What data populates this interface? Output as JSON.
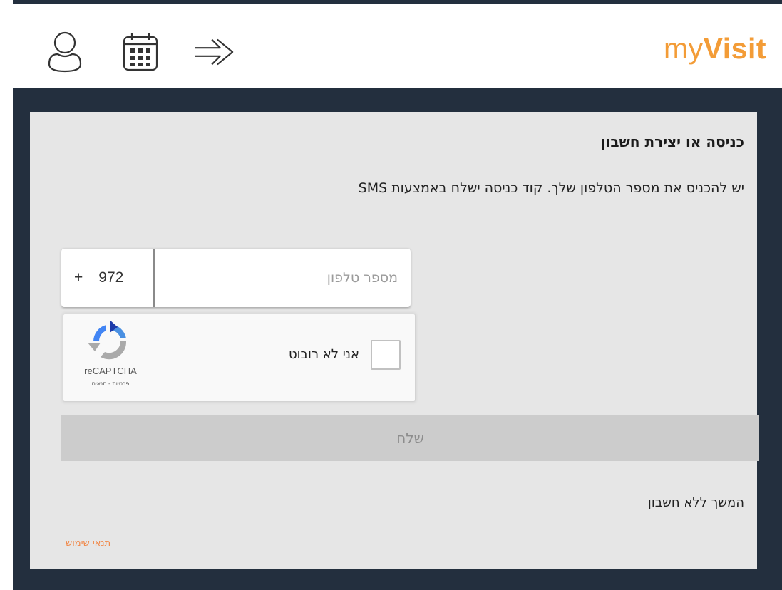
{
  "brand": {
    "logo_light": "my",
    "logo_bold": "Visit",
    "color": "#f39c37"
  },
  "header": {
    "icons": [
      "user-icon",
      "calendar-icon",
      "arrow-right-icon"
    ]
  },
  "login": {
    "title": "כניסה או יצירת חשבון",
    "instructions": "יש להכניס את מספר הטלפון שלך. קוד כניסה ישלח באמצעות SMS",
    "country_plus": "+",
    "country_code": "972",
    "phone_placeholder": "מספר טלפון",
    "phone_value": ""
  },
  "captcha": {
    "label": "אני לא רובוט",
    "brand": "reCAPTCHA",
    "links": "פרטיות - תנאים",
    "checked": false
  },
  "actions": {
    "send_label": "שלח",
    "continue_without_account": "המשך ללא חשבון",
    "terms_of_use": "תנאי שימוש"
  },
  "colors": {
    "frame": "#232f3e",
    "card": "#e6e6e6",
    "button": "#cccccc",
    "link": "#f1894a"
  }
}
